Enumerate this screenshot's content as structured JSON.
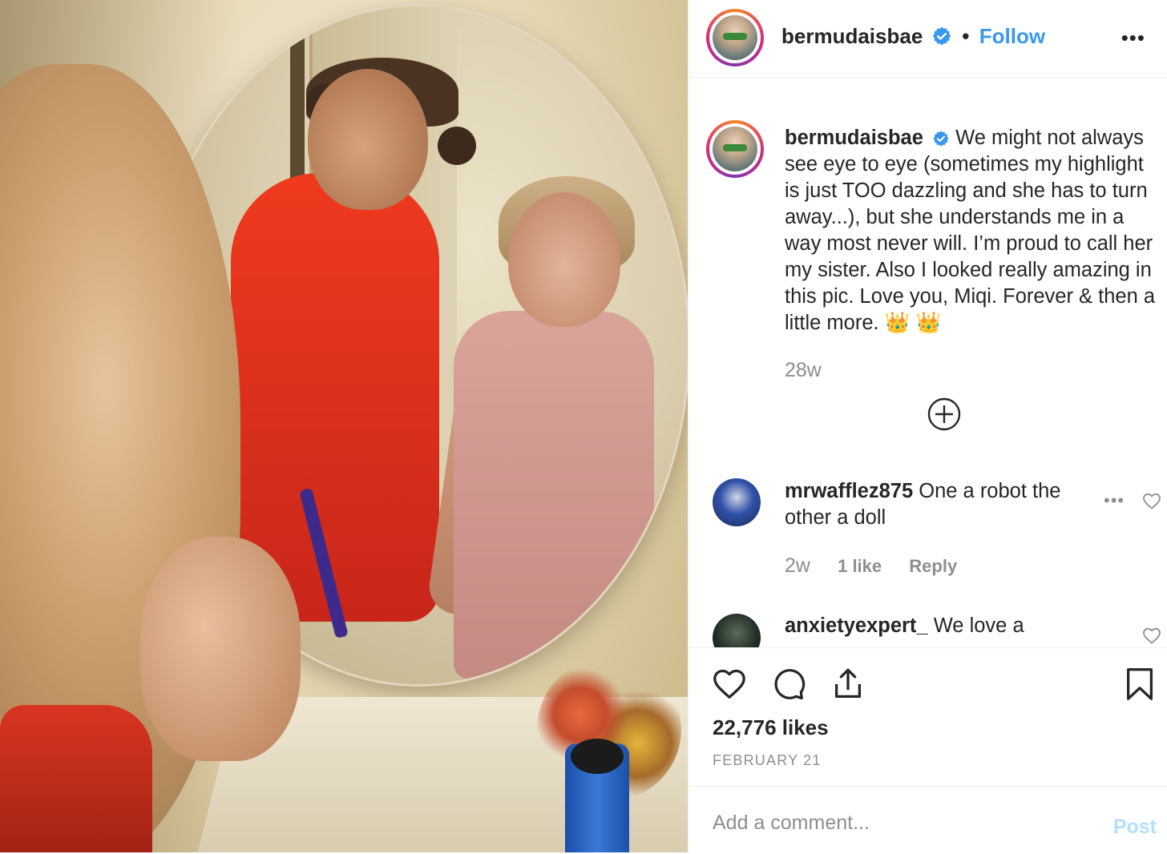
{
  "post": {
    "username": "bermudaisbae",
    "follow_label": "Follow",
    "separator": "•",
    "more_label": "•••"
  },
  "caption": {
    "username": "bermudaisbae",
    "text": "We might not always see eye to eye (sometimes my highlight is just TOO dazzling and she has to turn away...), but she understands me in a way most never will. I’m proud to call her my sister. Also I looked really amazing in this pic. Love you, Miqi. Forever & then a little more. 👑 👑",
    "time": "28w"
  },
  "comments": [
    {
      "username": "mrwafflez875",
      "text": "One a robot the other a doll",
      "time": "2w",
      "likes": "1 like",
      "reply_label": "Reply",
      "more_label": "•••"
    },
    {
      "username": "anxietyexpert_",
      "text": "We love a"
    }
  ],
  "stats": {
    "likes": "22,776 likes",
    "date": "FEBRUARY 21"
  },
  "composer": {
    "placeholder": "Add a comment...",
    "post_label": "Post"
  },
  "colors": {
    "link_blue": "#3897f0",
    "verified_blue": "#3897f0",
    "muted": "#8e8e8e",
    "post_disabled": "#b2dffc"
  }
}
